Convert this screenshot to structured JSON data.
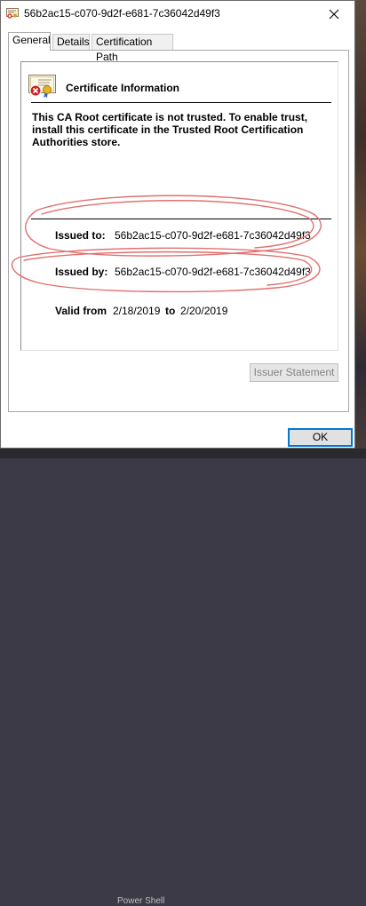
{
  "window": {
    "title": "56b2ac15-c070-9d2f-e681-7c36042d49f3"
  },
  "tabs": [
    {
      "label": "General",
      "active": true
    },
    {
      "label": "Details",
      "active": false
    },
    {
      "label": "Certification Path",
      "active": false
    }
  ],
  "certificate": {
    "heading": "Certificate Information",
    "warning": "This CA Root certificate is not trusted. To enable trust, install this certificate in the Trusted Root Certification Authorities store.",
    "issued_to_label": "Issued to:",
    "issued_to_value": "56b2ac15-c070-9d2f-e681-7c36042d49f3",
    "issued_by_label": "Issued by:",
    "issued_by_value": "56b2ac15-c070-9d2f-e681-7c36042d49f3",
    "valid_from_label": "Valid from",
    "valid_from_value": "2/18/2019",
    "valid_to_label": "to",
    "valid_to_value": "2/20/2019"
  },
  "buttons": {
    "issuer_statement": "Issuer Statement",
    "ok": "OK"
  },
  "icons": {
    "app": "certificate-icon",
    "cert": "certificate-error-icon",
    "close": "close-icon"
  },
  "colors": {
    "annotation": "#e07070",
    "focus": "#0078d7"
  },
  "background": {
    "text": "Power Shell"
  }
}
